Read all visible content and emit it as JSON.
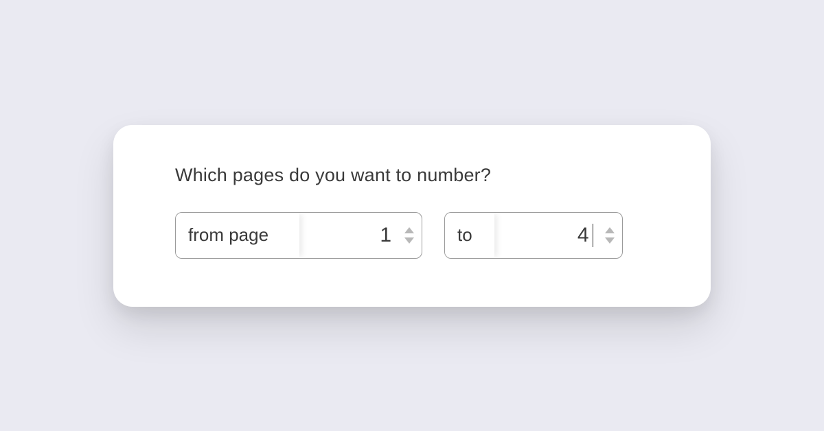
{
  "dialog": {
    "prompt": "Which pages do you want to number?",
    "from": {
      "label": "from page",
      "value": "1"
    },
    "to": {
      "label": "to",
      "value": "4"
    }
  }
}
